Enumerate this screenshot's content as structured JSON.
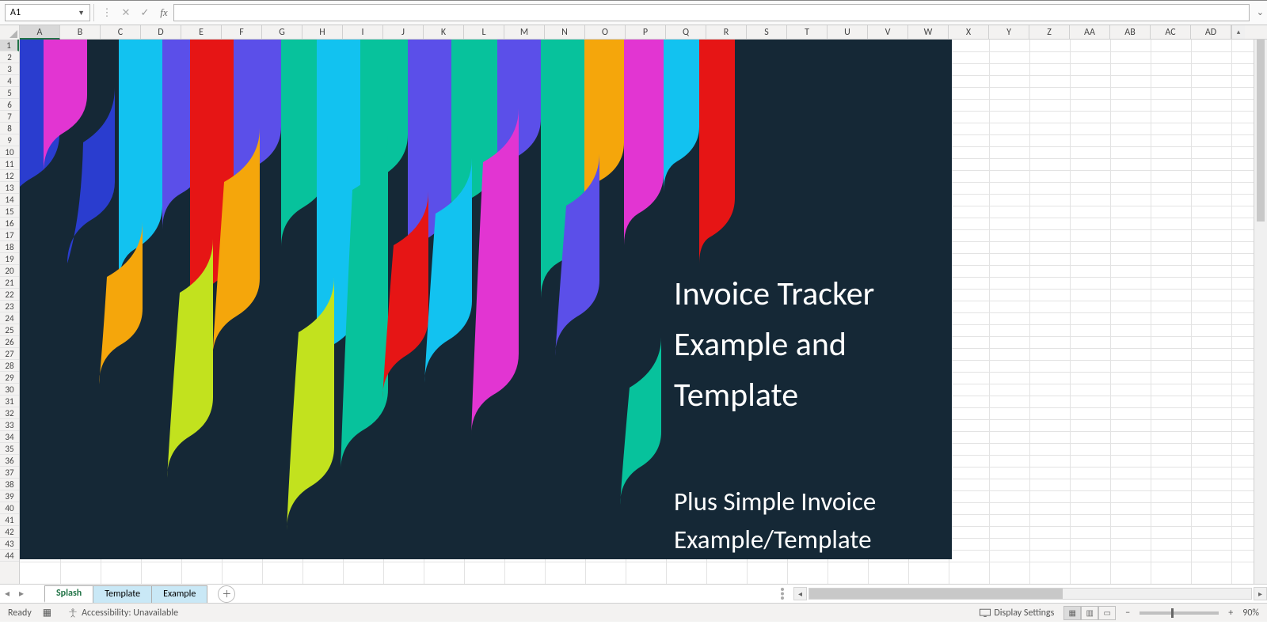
{
  "formula_bar": {
    "name_box_value": "A1",
    "formula_value": ""
  },
  "columns": [
    "A",
    "B",
    "C",
    "D",
    "E",
    "F",
    "G",
    "H",
    "I",
    "J",
    "K",
    "L",
    "M",
    "N",
    "O",
    "P",
    "Q",
    "R",
    "S",
    "T",
    "U",
    "V",
    "W",
    "X",
    "Y",
    "Z",
    "AA",
    "AB",
    "AC",
    "AD"
  ],
  "row_count": 44,
  "selected_col": "A",
  "selected_row": 1,
  "splash": {
    "title_line1": "Invoice Tracker",
    "title_line2": "Example and",
    "title_line3": "Template",
    "sub_line1": "Plus Simple Invoice",
    "sub_line2": "Example/Template"
  },
  "sheet_tabs": [
    {
      "label": "Splash",
      "active": true,
      "selected": false
    },
    {
      "label": "Template",
      "active": false,
      "selected": true
    },
    {
      "label": "Example",
      "active": false,
      "selected": true
    }
  ],
  "status": {
    "ready": "Ready",
    "accessibility": "Accessibility: Unavailable",
    "display_settings": "Display Settings",
    "zoom": "90%"
  }
}
